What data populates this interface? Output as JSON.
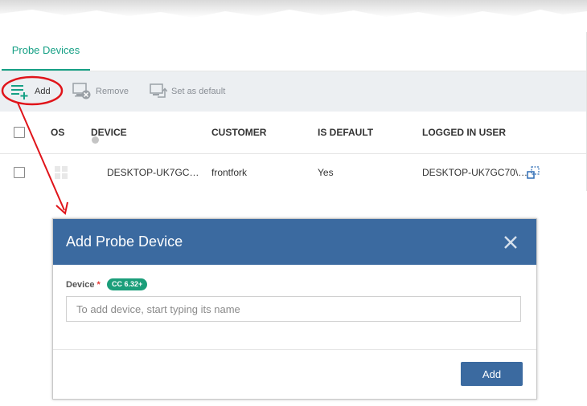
{
  "tabs": {
    "active_label": "Probe Devices"
  },
  "toolbar": {
    "add_label": "Add",
    "remove_label": "Remove",
    "set_default_label": "Set as default"
  },
  "table": {
    "columns": [
      "OS",
      "DEVICE",
      "CUSTOMER",
      "IS DEFAULT",
      "LOGGED IN USER"
    ],
    "rows": [
      {
        "device": "DESKTOP-UK7GC…",
        "customer": "frontfork",
        "is_default": "Yes",
        "logged_in_user": "DESKTOP-UK7GC70\\…",
        "os_icon": "windows-icon",
        "status_color": "#c4c4c4"
      }
    ]
  },
  "dialog": {
    "title": "Add Probe Device",
    "device_label": "Device",
    "required_mark": "*",
    "version_badge": "CC 6.32+",
    "device_placeholder": "To add device, start typing its name",
    "device_value": "",
    "add_button_label": "Add"
  },
  "colors": {
    "accent_green": "#16a085",
    "dialog_header": "#3b6aa0",
    "badge": "#1b9e7a",
    "annotation_red": "#e0141a"
  }
}
